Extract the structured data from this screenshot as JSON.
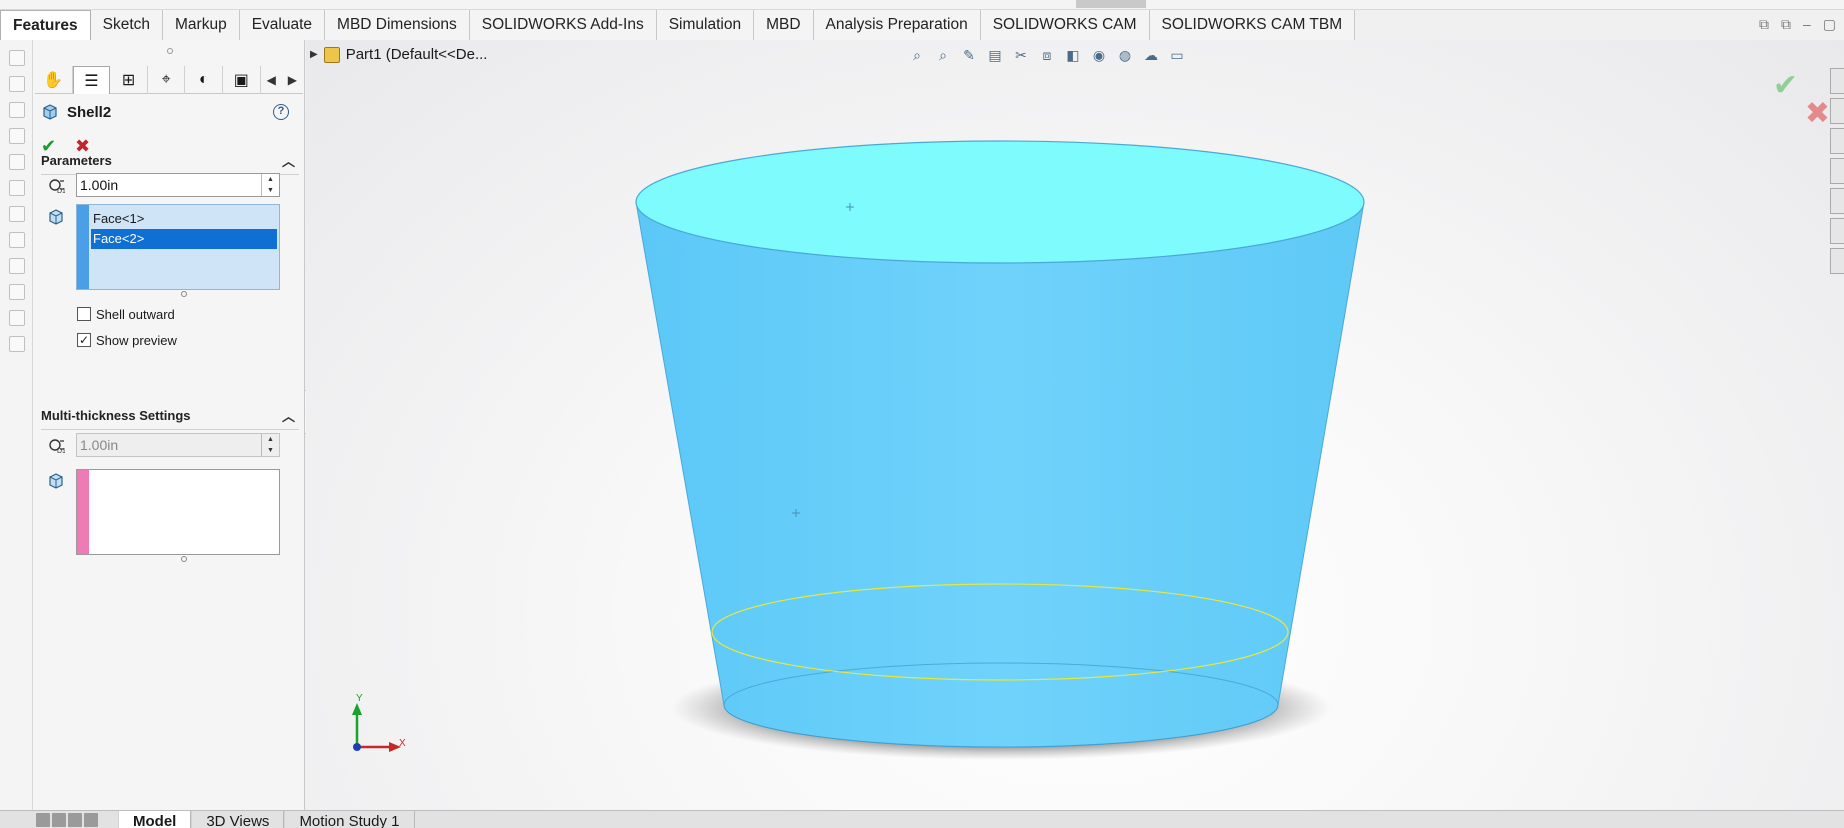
{
  "ribbon": {
    "tabs": [
      "Features",
      "Sketch",
      "Markup",
      "Evaluate",
      "MBD Dimensions",
      "SOLIDWORKS Add-Ins",
      "Simulation",
      "MBD",
      "Analysis Preparation",
      "SOLIDWORKS CAM",
      "SOLIDWORKS CAM TBM"
    ],
    "active": "Features"
  },
  "window_controls": [
    "restore-left-icon",
    "restore-right-icon",
    "minimize-icon",
    "maximize-icon"
  ],
  "property_manager": {
    "title": "Shell2",
    "tabs": [
      "feature-manager-icon",
      "property-manager-icon",
      "configuration-manager-icon",
      "dimxpert-icon",
      "display-manager-icon",
      "cam-tree-icon"
    ],
    "parameters": {
      "heading": "Parameters",
      "thickness": "1.00in",
      "faces": [
        "Face<1>",
        "Face<2>"
      ],
      "selected_face": "Face<2>",
      "shell_outward_label": "Shell outward",
      "shell_outward_checked": false,
      "show_preview_label": "Show preview",
      "show_preview_checked": true
    },
    "multi_thickness": {
      "heading": "Multi-thickness Settings",
      "thickness": "1.00in"
    }
  },
  "viewport": {
    "breadcrumb": "Part1  (Default<<De...",
    "toolbar_icons": [
      "zoom-to-fit-icon",
      "zoom-area-icon",
      "previous-view-icon",
      "section-view-icon",
      "dynamic-annotation-icon",
      "view-orientation-icon",
      "display-style-icon",
      "hide-show-icon",
      "edit-appearance-icon",
      "apply-scene-icon",
      "view-settings-icon"
    ],
    "triad": {
      "y_label": "Y",
      "x_label": "X"
    },
    "colors": {
      "part": "#66d6ff",
      "edge_highlight": "#e8e83a",
      "shadow": "#6a6a6a"
    }
  },
  "bottom_tabs": [
    "Model",
    "3D Views",
    "Motion Study 1"
  ],
  "bottom_active": "Model"
}
